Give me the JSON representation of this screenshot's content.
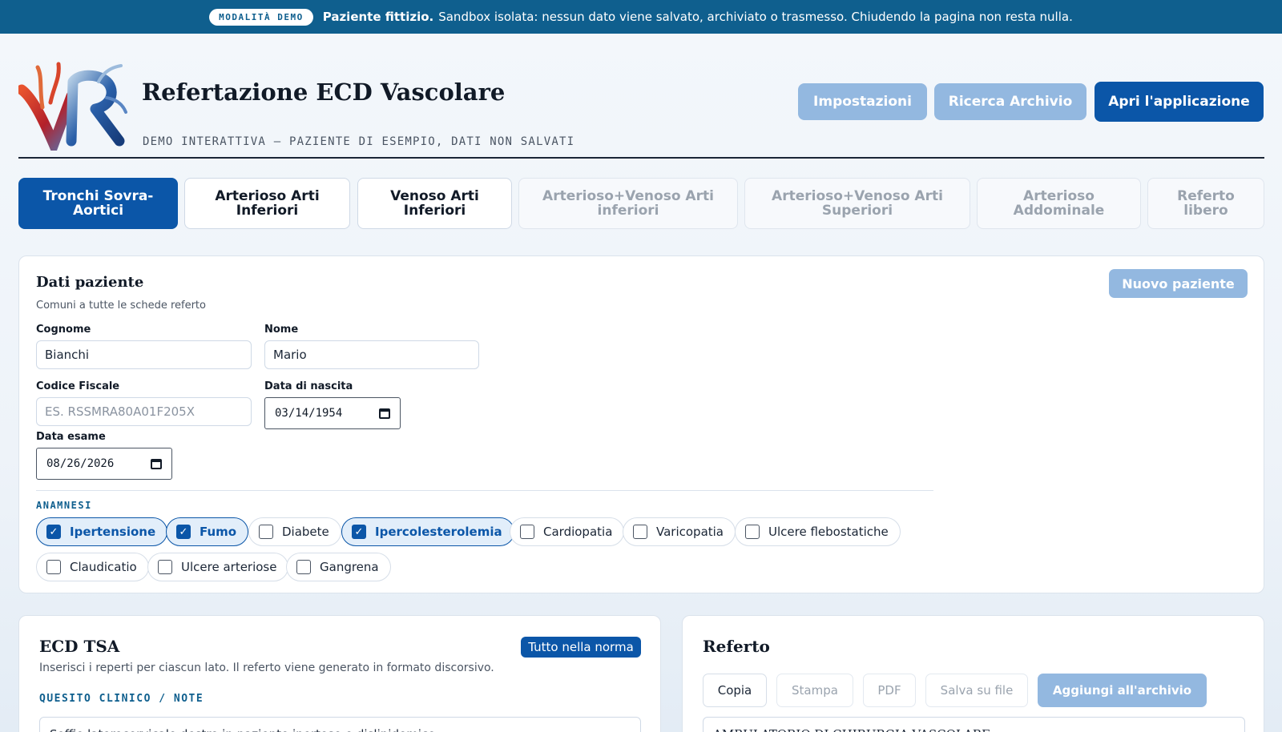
{
  "banner": {
    "badge": "MODALITÀ DEMO",
    "bold": "Paziente fittizio.",
    "text": "Sandbox isolata: nessun dato viene salvato, archiviato o trasmesso. Chiudendo la pagina non resta nulla."
  },
  "header": {
    "title": "Refertazione ECD Vascolare",
    "subtitle": "DEMO INTERATTIVA — PAZIENTE DI ESEMPIO, DATI NON SALVATI",
    "buttons": {
      "settings": "Impostazioni",
      "archive_search": "Ricerca Archivio",
      "open_app": "Apri l'applicazione"
    }
  },
  "tabs": [
    "Tronchi Sovra-Aortici",
    "Arterioso Arti Inferiori",
    "Venoso Arti Inferiori",
    "Arterioso+Venoso Arti inferiori",
    "Arterioso+Venoso Arti Superiori",
    "Arterioso Addominale",
    "Referto libero"
  ],
  "patient": {
    "title": "Dati paziente",
    "subtitle": "Comuni a tutte le schede referto",
    "new_patient": "Nuovo paziente",
    "fields": {
      "surname_label": "Cognome",
      "surname_value": "Bianchi",
      "name_label": "Nome",
      "name_value": "Mario",
      "cf_label": "Codice Fiscale",
      "cf_placeholder": "ES. RSSMRA80A01F205X",
      "dob_label": "Data di nascita",
      "dob_value": "03/14/1954",
      "exam_label": "Data esame",
      "exam_value": "08/26/2026"
    },
    "anamnesis_label": "ANAMNESI",
    "anamnesis": [
      {
        "label": "Ipertensione",
        "checked": true
      },
      {
        "label": "Fumo",
        "checked": true
      },
      {
        "label": "Diabete",
        "checked": false
      },
      {
        "label": "Ipercolesterolemia",
        "checked": true
      },
      {
        "label": "Cardiopatia",
        "checked": false
      },
      {
        "label": "Varicopatia",
        "checked": false
      },
      {
        "label": "Ulcere flebostatiche",
        "checked": false
      },
      {
        "label": "Claudicatio",
        "checked": false
      },
      {
        "label": "Ulcere arteriose",
        "checked": false
      },
      {
        "label": "Gangrena",
        "checked": false
      }
    ]
  },
  "ecd": {
    "title": "ECD TSA",
    "normal_button": "Tutto nella norma",
    "description": "Inserisci i reperti per ciascun lato. Il referto viene generato in formato discorsivo.",
    "section_label": "QUESITO CLINICO / NOTE",
    "notes_value": "Soffio laterocervicale destro in paziente iperteso e dislipidemico."
  },
  "report": {
    "title": "Referto",
    "tools": {
      "copy": "Copia",
      "print": "Stampa",
      "pdf": "PDF",
      "save": "Salva su file",
      "add_archive": "Aggiungi all'archivio"
    },
    "first_line": "AMBULATORIO DI CHIRURGIA VASCOLARE"
  },
  "colors": {
    "banner": "#0f5f8e",
    "primary": "#0b56a8",
    "primary_disabled": "#93b8e0"
  }
}
